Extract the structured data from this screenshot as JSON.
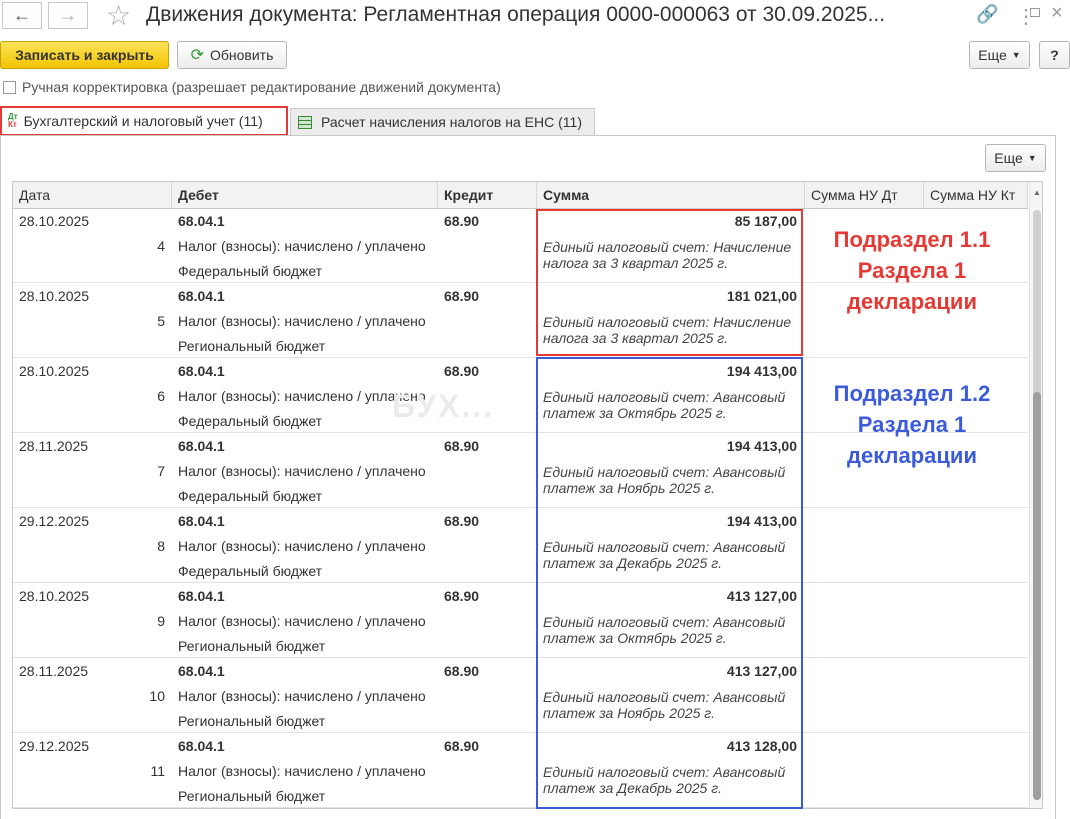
{
  "window": {
    "title": "Движения документа: Регламентная операция 0000-000063 от 30.09.2025...",
    "back_icon": "arrow-left-icon",
    "forward_icon": "arrow-right-icon",
    "favorite_icon": "star-icon",
    "link_icon": "link-icon",
    "more_icon": "more-vertical-icon",
    "maximize_icon": "maximize-icon",
    "close_icon": "close-icon"
  },
  "toolbar": {
    "save_close_label": "Записать и закрыть",
    "refresh_label": "Обновить",
    "more_label": "Еще",
    "help_label": "?"
  },
  "manual_correction": {
    "label": "Ручная корректировка (разрешает редактирование движений документа)",
    "checked": false
  },
  "tabs": [
    {
      "label": "Бухгалтерский и налоговый учет (11)",
      "icon": "dt-kt-icon",
      "active": true
    },
    {
      "label": "Расчет начисления налогов на ЕНС (11)",
      "icon": "table-icon",
      "active": false
    }
  ],
  "panel": {
    "more_label": "Еще"
  },
  "grid": {
    "columns": [
      "Дата",
      "Дебет",
      "Кредит",
      "Сумма",
      "Сумма НУ Дт",
      "Сумма НУ Кт"
    ],
    "rows": [
      {
        "date": "28.10.2025",
        "num": "4",
        "debit": "68.04.1",
        "debit_sub1": "Налог (взносы): начислено / уплачено",
        "debit_sub2": "Федеральный бюджет",
        "credit": "68.90",
        "amount": "85 187,00",
        "desc": "Единый налоговый счет: Начисление налога за 3 квартал 2025 г."
      },
      {
        "date": "28.10.2025",
        "num": "5",
        "debit": "68.04.1",
        "debit_sub1": "Налог (взносы): начислено / уплачено",
        "debit_sub2": "Региональный бюджет",
        "credit": "68.90",
        "amount": "181 021,00",
        "desc": "Единый налоговый счет: Начисление налога за 3 квартал 2025 г."
      },
      {
        "date": "28.10.2025",
        "num": "6",
        "debit": "68.04.1",
        "debit_sub1": "Налог (взносы): начислено / уплачено",
        "debit_sub2": "Федеральный бюджет",
        "credit": "68.90",
        "amount": "194 413,00",
        "desc": "Единый налоговый счет: Авансовый платеж за Октябрь 2025 г."
      },
      {
        "date": "28.11.2025",
        "num": "7",
        "debit": "68.04.1",
        "debit_sub1": "Налог (взносы): начислено / уплачено",
        "debit_sub2": "Федеральный бюджет",
        "credit": "68.90",
        "amount": "194 413,00",
        "desc": "Единый налоговый счет: Авансовый платеж за Ноябрь 2025 г."
      },
      {
        "date": "29.12.2025",
        "num": "8",
        "debit": "68.04.1",
        "debit_sub1": "Налог (взносы): начислено / уплачено",
        "debit_sub2": "Федеральный бюджет",
        "credit": "68.90",
        "amount": "194 413,00",
        "desc": "Единый налоговый счет: Авансовый платеж за Декабрь 2025 г."
      },
      {
        "date": "28.10.2025",
        "num": "9",
        "debit": "68.04.1",
        "debit_sub1": "Налог (взносы): начислено / уплачено",
        "debit_sub2": "Региональный бюджет",
        "credit": "68.90",
        "amount": "413 127,00",
        "desc": "Единый налоговый счет: Авансовый платеж за Октябрь 2025 г."
      },
      {
        "date": "28.11.2025",
        "num": "10",
        "debit": "68.04.1",
        "debit_sub1": "Налог (взносы): начислено / уплачено",
        "debit_sub2": "Региональный бюджет",
        "credit": "68.90",
        "amount": "413 127,00",
        "desc": "Единый налоговый счет: Авансовый платеж за Ноябрь 2025 г."
      },
      {
        "date": "29.12.2025",
        "num": "11",
        "debit": "68.04.1",
        "debit_sub1": "Налог (взносы): начислено / уплачено",
        "debit_sub2": "Региональный бюджет",
        "credit": "68.90",
        "amount": "413 128,00",
        "desc": "Единый налоговый счет: Авансовый платеж за Декабрь 2025 г."
      }
    ]
  },
  "annotations": {
    "section_1_1": [
      "Подраздел 1.1",
      "Раздела 1",
      "декларации"
    ],
    "section_1_2": [
      "Подраздел 1.2",
      "Раздела 1",
      "декларации"
    ],
    "color_1_1": "#e53935",
    "color_1_2": "#3b5bdb"
  },
  "watermark": "БУХ..."
}
